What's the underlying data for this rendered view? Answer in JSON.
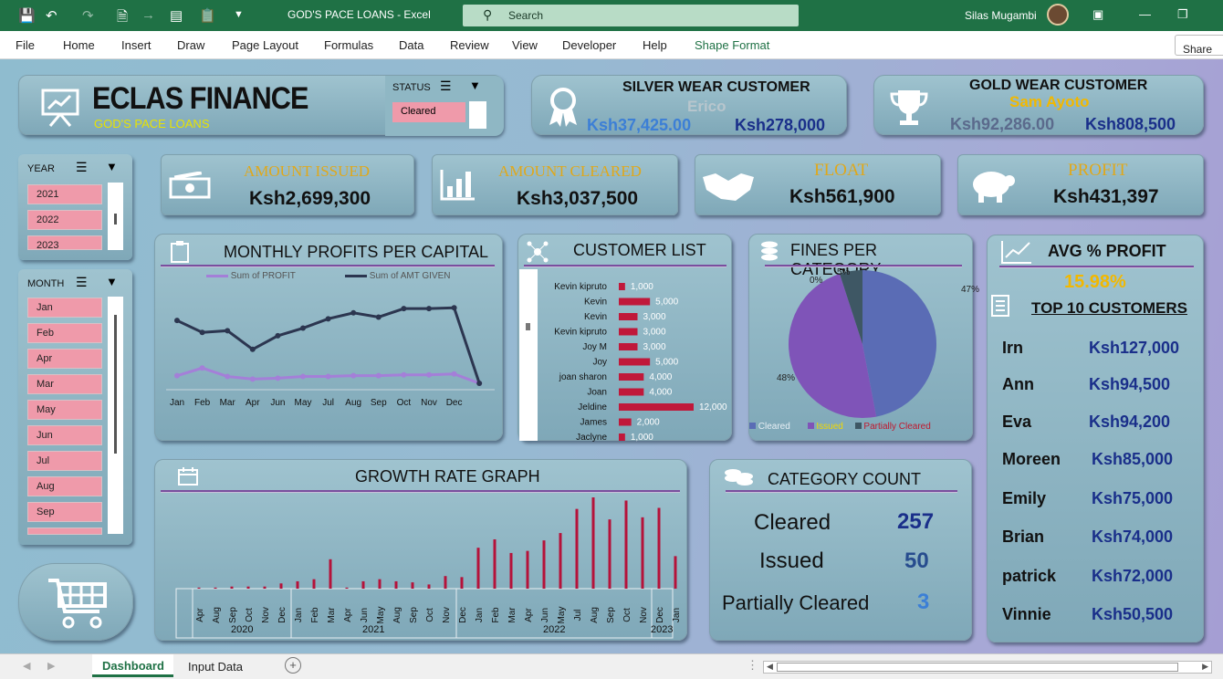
{
  "titlebar": {
    "title": "GOD'S PACE LOANS  -  Excel",
    "search": "Search",
    "user": "Silas Mugambi"
  },
  "menu": [
    "File",
    "Home",
    "Insert",
    "Draw",
    "Page Layout",
    "Formulas",
    "Data",
    "Review",
    "View",
    "Developer",
    "Help",
    "Shape Format"
  ],
  "share": "Share",
  "brand": {
    "name": "ECLAS FINANCE",
    "tagline": "GOD'S PACE LOANS"
  },
  "status_slicer": {
    "header": "STATUS",
    "selected": "Cleared"
  },
  "silver": {
    "title": "SILVER WEAR CUSTOMER",
    "name": "Erico",
    "val1": "Ksh37,425.00",
    "val2": "Ksh278,000"
  },
  "gold": {
    "title": "GOLD WEAR CUSTOMER",
    "name": "Sam Ayoto",
    "val1": "Ksh92,286.00",
    "val2": "Ksh808,500"
  },
  "year_slicer": {
    "header": "YEAR",
    "items": [
      "2021",
      "2022",
      "2023"
    ]
  },
  "month_slicer": {
    "header": "MONTH",
    "items": [
      "Jan",
      "Feb",
      "Apr",
      "Mar",
      "May",
      "Jun",
      "Jul",
      "Aug",
      "Sep"
    ]
  },
  "kpis": [
    {
      "label": "AMOUNT ISSUED",
      "value": "Ksh2,699,300"
    },
    {
      "label": "AMOUNT CLEARED",
      "value": "Ksh3,037,500"
    },
    {
      "label": "FLOAT",
      "value": "Ksh561,900"
    },
    {
      "label": "PROFIT",
      "value": "Ksh431,397"
    }
  ],
  "monthly": {
    "title": "MONTHLY PROFITS PER CAPITAL",
    "legend1": "Sum of PROFIT",
    "legend2": "Sum of AMT GIVEN"
  },
  "customer_list": {
    "title": "CUSTOMER LIST"
  },
  "fines": {
    "title": "FINES PER CATEGORY",
    "legend": [
      "Cleared",
      "Issued",
      "Partially Cleared"
    ],
    "labels": [
      "47%",
      "48%",
      "0%",
      "5%"
    ]
  },
  "growth": {
    "title": "GROWTH RATE GRAPH",
    "years": [
      "2020",
      "2021",
      "2022",
      "2023"
    ]
  },
  "category_count": {
    "title": "CATEGORY COUNT",
    "rows": [
      {
        "label": "Cleared",
        "value": "257"
      },
      {
        "label": "Issued",
        "value": "50"
      },
      {
        "label": "Partially Cleared",
        "value": "3"
      }
    ]
  },
  "avg": {
    "title": "AVG % PROFIT",
    "value": "15.98%",
    "top_title": "TOP 10 CUSTOMERS",
    "top": [
      {
        "name": "Irn",
        "value": "Ksh127,000"
      },
      {
        "name": "Ann",
        "value": "Ksh94,500"
      },
      {
        "name": "Eva",
        "value": "Ksh94,200"
      },
      {
        "name": "Moreen",
        "value": "Ksh85,000"
      },
      {
        "name": "Emily",
        "value": "Ksh75,000"
      },
      {
        "name": "Brian",
        "value": "Ksh74,000"
      },
      {
        "name": "patrick",
        "value": "Ksh72,000"
      },
      {
        "name": "Vinnie",
        "value": "Ksh50,500"
      }
    ]
  },
  "tabs": [
    "Dashboard",
    "Input Data"
  ],
  "chart_data": [
    {
      "type": "line",
      "title": "MONTHLY PROFITS PER CAPITAL",
      "categories": [
        "Jan",
        "Feb",
        "Mar",
        "Apr",
        "Jun",
        "May",
        "Jul",
        "Aug",
        "Sep",
        "Oct",
        "Nov",
        "Dec"
      ],
      "series": [
        {
          "name": "Sum of PROFIT",
          "values": [
            9,
            18,
            8,
            5,
            6,
            8,
            8,
            9,
            9,
            10,
            10,
            11,
            0
          ]
        },
        {
          "name": "Sum of AMT GIVEN",
          "values": [
            74,
            60,
            62,
            40,
            56,
            65,
            76,
            83,
            78,
            88,
            88,
            89,
            0
          ]
        }
      ],
      "ylim": [
        0,
        100
      ]
    },
    {
      "type": "bar",
      "title": "CUSTOMER LIST",
      "categories": [
        "Kevin kipruto",
        "Kevin",
        "Kevin",
        "Kevin kipruto",
        "Joy M",
        "Joy",
        "joan sharon",
        "Joan",
        "Jeldine",
        "James",
        "Jaclyne"
      ],
      "values": [
        1000,
        5000,
        3000,
        3000,
        3000,
        5000,
        4000,
        4000,
        12000,
        2000,
        1000
      ],
      "labels": [
        "1,000",
        "5,000",
        "3,000",
        "3,000",
        "3,000",
        "5,000",
        "4,000",
        "4,000",
        "12,000",
        "2,000",
        "1,000"
      ]
    },
    {
      "type": "pie",
      "title": "FINES PER CATEGORY",
      "categories": [
        "Cleared",
        "Issued",
        "Partially Cleared"
      ],
      "values": [
        47,
        48,
        5
      ],
      "colors": [
        "#5a6cb5",
        "#7f54b8",
        "#3e5764"
      ]
    },
    {
      "type": "bar",
      "title": "GROWTH RATE GRAPH",
      "categories": [
        "Apr",
        "Aug",
        "Sep",
        "Oct",
        "Nov",
        "Dec",
        "Jan",
        "Feb",
        "Mar",
        "Apr",
        "Jun",
        "May",
        "Aug",
        "Sep",
        "Oct",
        "Nov",
        "Dec",
        "Jan",
        "Feb",
        "Mar",
        "Apr",
        "Jun",
        "May",
        "Jul",
        "Aug",
        "Sep",
        "Oct",
        "Nov",
        "Dec",
        "Jan"
      ],
      "values": [
        1,
        1,
        2,
        2,
        2,
        5,
        7,
        9,
        28,
        1,
        7,
        9,
        7,
        6,
        4,
        12,
        11,
        39,
        47,
        34,
        36,
        46,
        53,
        76,
        87,
        66,
        84,
        68,
        77,
        31
      ]
    }
  ]
}
